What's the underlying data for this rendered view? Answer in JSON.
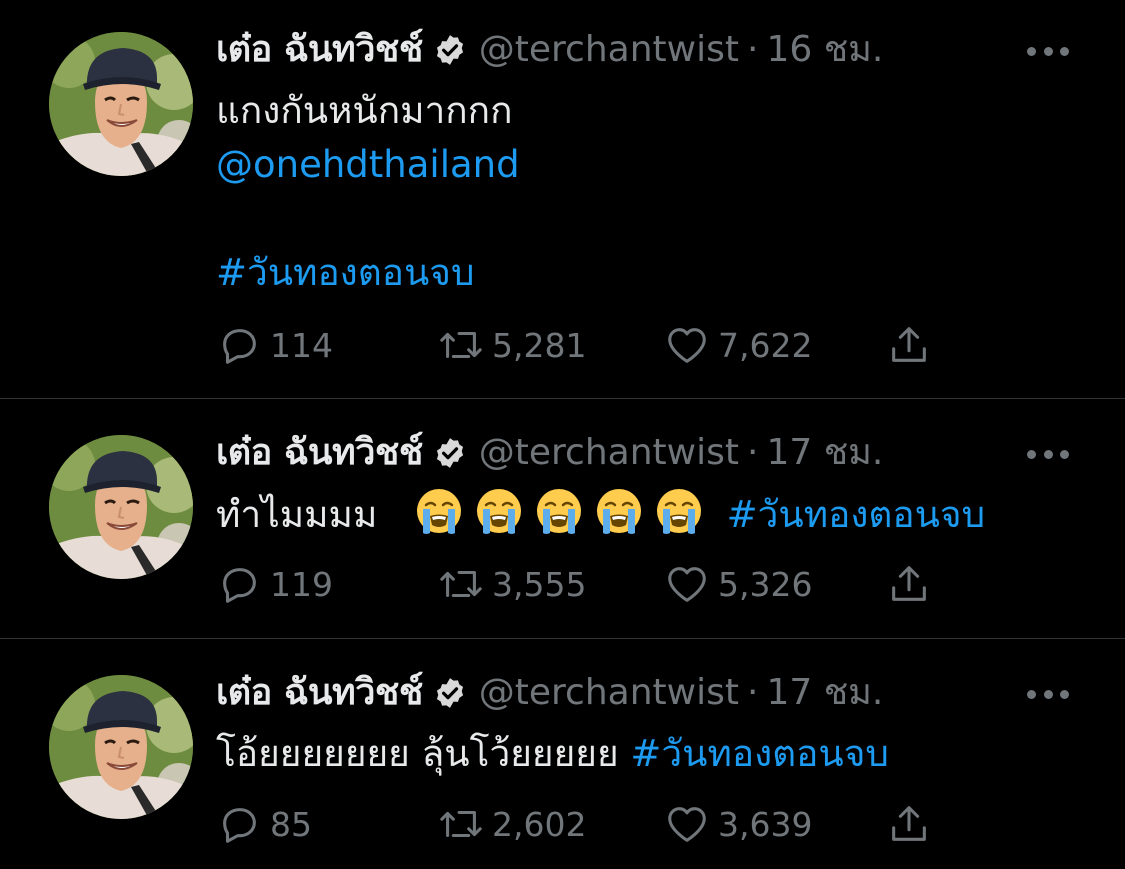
{
  "tweets": [
    {
      "display_name": "เต๋อ ฉันทวิชช์",
      "handle": "@terchantwist",
      "separator": "·",
      "time": "16 ชม.",
      "text_line1": "แกงกันหนักมากกก",
      "mention": "@onehdthailand",
      "hashtag": "#วันทองตอนจบ",
      "replies": "114",
      "retweets": "5,281",
      "likes": "7,622"
    },
    {
      "display_name": "เต๋อ ฉันทวิชช์",
      "handle": "@terchantwist",
      "separator": "·",
      "time": "17 ชม.",
      "text": "ทำไมมมม",
      "emoji": [
        "loudly-crying-face",
        "loudly-crying-face",
        "loudly-crying-face",
        "loudly-crying-face",
        "loudly-crying-face"
      ],
      "hashtag": "#วันทองตอนจบ",
      "replies": "119",
      "retweets": "3,555",
      "likes": "5,326"
    },
    {
      "display_name": "เต๋อ ฉันทวิชช์",
      "handle": "@terchantwist",
      "separator": "·",
      "time": "17 ชม.",
      "text": "โอ้ยยยยยยย ลุ้นโว้ยยยยย",
      "hashtag": "#วันทองตอนจบ",
      "replies": "85",
      "retweets": "2,602",
      "likes": "3,639"
    }
  ],
  "icons": {
    "verified": "verified-badge-icon",
    "more": "more-dots-icon",
    "reply": "reply-bubble-icon",
    "retweet": "retweet-icon",
    "like": "heart-icon",
    "share": "share-upload-icon"
  },
  "colors": {
    "background": "#000000",
    "text": "#e7e9ea",
    "secondary": "#71767b",
    "link": "#1d9bf0",
    "divider": "#2f3336"
  }
}
